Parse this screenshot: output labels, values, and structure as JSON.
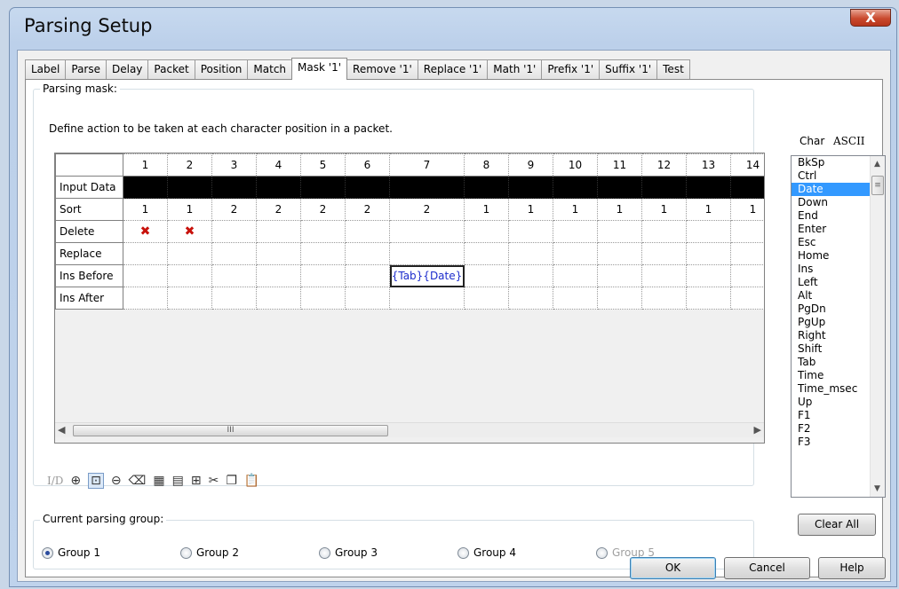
{
  "window": {
    "title": "Parsing Setup",
    "close_glyph": "X"
  },
  "tabs": [
    {
      "label": "Label"
    },
    {
      "label": "Parse"
    },
    {
      "label": "Delay"
    },
    {
      "label": "Packet"
    },
    {
      "label": "Position"
    },
    {
      "label": "Match"
    },
    {
      "label": "Mask '1'",
      "active": true
    },
    {
      "label": "Remove '1'"
    },
    {
      "label": "Replace '1'"
    },
    {
      "label": "Math '1'"
    },
    {
      "label": "Prefix '1'"
    },
    {
      "label": "Suffix '1'"
    },
    {
      "label": "Test"
    }
  ],
  "mask": {
    "legend": "Parsing mask:",
    "description": "Define action to be taken at each character position in a packet.",
    "columns": [
      "1",
      "2",
      "3",
      "4",
      "5",
      "6",
      "7",
      "8",
      "9",
      "10",
      "11",
      "12",
      "13",
      "14"
    ],
    "rows": {
      "input_data": "Input Data",
      "sort": "Sort",
      "delete": "Delete",
      "replace": "Replace",
      "ins_before": "Ins Before",
      "ins_after": "Ins After"
    },
    "sort_values": [
      "1",
      "1",
      "2",
      "2",
      "2",
      "2",
      "2",
      "1",
      "1",
      "1",
      "1",
      "1",
      "1",
      "1"
    ],
    "delete_marks": [
      "✖",
      "✖",
      "",
      "",
      "",
      "",
      "",
      "",
      "",
      "",
      "",
      "",
      "",
      ""
    ],
    "ins_before_values": [
      "",
      "",
      "",
      "",
      "",
      "",
      "{Tab}{Date}",
      "",
      "",
      "",
      "",
      "",
      "",
      ""
    ],
    "scroll_grip": "III"
  },
  "toolbar": {
    "io_label": "I/D"
  },
  "group": {
    "legend": "Current parsing group:",
    "options": [
      {
        "label": "Group 1",
        "checked": true
      },
      {
        "label": "Group 2"
      },
      {
        "label": "Group 3"
      },
      {
        "label": "Group 4"
      },
      {
        "label": "Group 5",
        "disabled": true
      }
    ]
  },
  "charlist": {
    "header_char": "Char",
    "header_ascii": "ASCII",
    "items": [
      "BkSp",
      "Ctrl",
      "Date",
      "Down",
      "End",
      "Enter",
      "Esc",
      "Home",
      "Ins",
      "Left",
      "Alt",
      "PgDn",
      "PgUp",
      "Right",
      "Shift",
      "Tab",
      "Time",
      "Time_msec",
      "Up",
      "F1",
      "F2",
      "F3"
    ],
    "selected": "Date"
  },
  "buttons": {
    "clear_all": "Clear All",
    "ok": "OK",
    "cancel": "Cancel",
    "help": "Help"
  },
  "colors": {
    "selection": "#3399ff",
    "delete_mark": "#c8120c",
    "insert_text": "#1c2ccc"
  }
}
